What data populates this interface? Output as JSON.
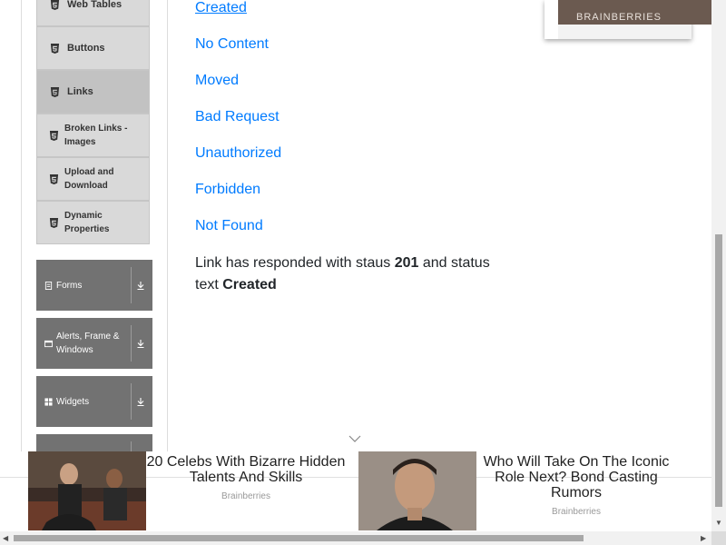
{
  "sidebar": {
    "subitems": [
      {
        "label": "Web Tables"
      },
      {
        "label": "Buttons"
      },
      {
        "label": "Links"
      },
      {
        "label": "Broken Links - Images"
      },
      {
        "label": "Upload and Download"
      },
      {
        "label": "Dynamic Properties"
      }
    ],
    "groups": [
      {
        "label": "Forms",
        "icon": "file-icon"
      },
      {
        "label": "Alerts, Frame & Windows",
        "icon": "window-icon"
      },
      {
        "label": "Widgets",
        "icon": "grid-icon"
      }
    ]
  },
  "main": {
    "links": [
      "Created",
      "No Content",
      "Moved",
      "Bad Request",
      "Unauthorized",
      "Forbidden",
      "Not Found"
    ],
    "result": {
      "prefix": "Link has responded with staus",
      "code": "201",
      "middle": "and status text",
      "status_text": "Created"
    }
  },
  "top_ad": {
    "brand": "BRAINBERRIES"
  },
  "bottom_ad": {
    "items": [
      {
        "title": "20 Celebs With Bizarre Hidden Talents And Skills",
        "source": "Brainberries"
      },
      {
        "title": "Who Will Take On The Iconic Role Next? Bond Casting Rumors",
        "source": "Brainberries"
      }
    ]
  },
  "colors": {
    "link": "#007bff",
    "group_bg": "#727272",
    "subitem_bg": "#d9d9d9",
    "active_bg": "#c2c2c2"
  }
}
